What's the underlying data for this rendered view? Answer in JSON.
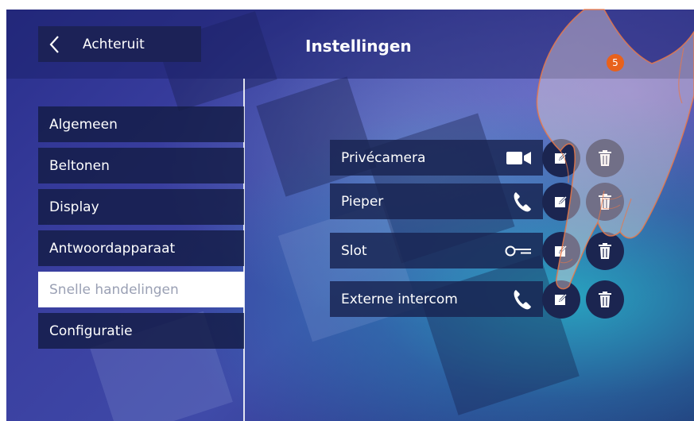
{
  "header": {
    "back_label": "Achteruit",
    "title": "Instellingen"
  },
  "menu": {
    "items": [
      {
        "label": "Algemeen",
        "active": false
      },
      {
        "label": "Beltonen",
        "active": false
      },
      {
        "label": "Display",
        "active": false
      },
      {
        "label": "Antwoordapparaat",
        "active": false
      },
      {
        "label": "Snelle handelingen",
        "active": true
      },
      {
        "label": "Configuratie",
        "active": false
      }
    ]
  },
  "actions": [
    {
      "label": "Privécamera",
      "icon": "video-camera-icon"
    },
    {
      "label": "Pieper",
      "icon": "phone-icon"
    },
    {
      "label": "Slot",
      "icon": "key-icon"
    },
    {
      "label": "Externe intercom",
      "icon": "phone-icon"
    }
  ],
  "step_badge": "5",
  "colors": {
    "menu_bg": "#141c46",
    "active_bg": "#ffffff",
    "active_text": "#9aa0b4",
    "badge": "#e8611c",
    "button_bg": "#1b2550"
  }
}
